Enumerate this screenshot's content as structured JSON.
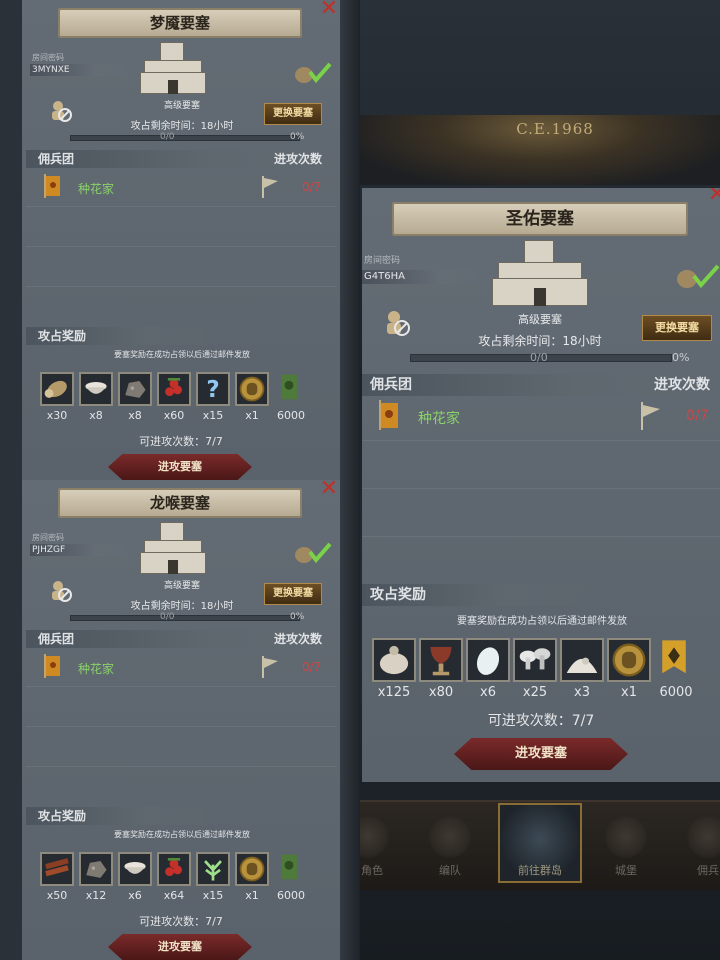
{
  "background": {
    "banner_text": "C.E.1968",
    "tabs": [
      {
        "label": "角色"
      },
      {
        "label": "编队"
      },
      {
        "label": "前往群岛"
      },
      {
        "label": "城堡"
      },
      {
        "label": "佣兵"
      }
    ]
  },
  "labels": {
    "room_code": "房间密码",
    "fortress_grade": "高级要塞",
    "time_left": "攻占剩余时间：18小时",
    "swap": "更换要塞",
    "progress": "0/0",
    "percent": "0%",
    "mercenary": "佣兵团",
    "attack_count": "进攻次数",
    "guild_name": "种花家",
    "reward_title": "攻占奖励",
    "reward_note": "要塞奖励在成功占领以后通过邮件发放",
    "remaining_label": "可进攻次数：7/7",
    "attack_btn": "进攻要塞",
    "fraction": "0/7",
    "close": "✕"
  },
  "panels": [
    {
      "title": "梦魇要塞",
      "code": "3MYNXE",
      "rewards": [
        {
          "icon": "wood-log-icon",
          "qty": "x30"
        },
        {
          "icon": "bowl-icon",
          "qty": "x8"
        },
        {
          "icon": "ore-icon",
          "qty": "x8"
        },
        {
          "icon": "berries-icon",
          "qty": "x60"
        },
        {
          "icon": "question-mark-icon",
          "qty": "x15"
        },
        {
          "icon": "helmet-coin-icon",
          "qty": "x1"
        },
        {
          "icon": "banner-icon",
          "qty": "6000"
        }
      ]
    },
    {
      "title": "龙喉要塞",
      "code": "PJHZGF",
      "rewards": [
        {
          "icon": "planks-icon",
          "qty": "x50"
        },
        {
          "icon": "ore-icon",
          "qty": "x12"
        },
        {
          "icon": "bowl-icon",
          "qty": "x6"
        },
        {
          "icon": "berries-icon",
          "qty": "x64"
        },
        {
          "icon": "plant-icon",
          "qty": "x15"
        },
        {
          "icon": "helmet-coin-icon",
          "qty": "x1"
        },
        {
          "icon": "banner-icon",
          "qty": "6000"
        }
      ]
    },
    {
      "title": "圣佑要塞",
      "code": "G4T6HA",
      "rewards": [
        {
          "icon": "sack-icon",
          "qty": "x125"
        },
        {
          "icon": "goblet-icon",
          "qty": "x80"
        },
        {
          "icon": "egg-icon",
          "qty": "x6"
        },
        {
          "icon": "mushrooms-icon",
          "qty": "x25"
        },
        {
          "icon": "salt-pile-icon",
          "qty": "x3"
        },
        {
          "icon": "helmet-coin-icon",
          "qty": "x1"
        },
        {
          "icon": "gold-banner-icon",
          "qty": "6000"
        }
      ]
    }
  ]
}
